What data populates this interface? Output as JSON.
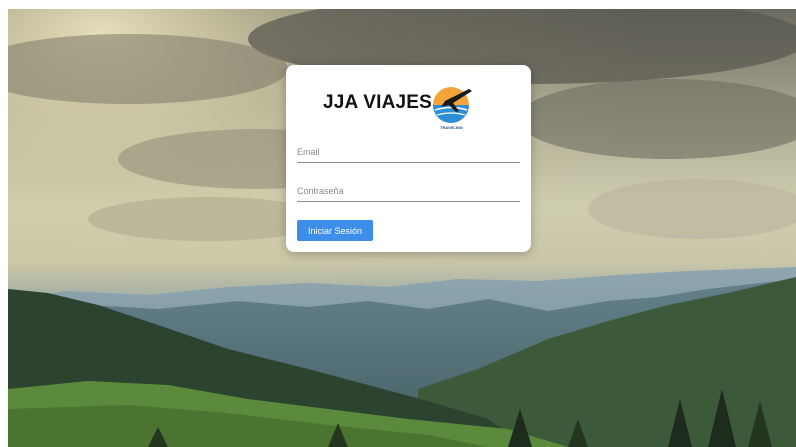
{
  "login": {
    "brand": "JJA VIAJES",
    "logo_text": "TRAVELING",
    "email_placeholder": "Email",
    "password_placeholder": "Contraseña",
    "submit_label": "Iniciar Sesión"
  },
  "colors": {
    "button": "#3d8ee8",
    "card": "#ffffff"
  }
}
